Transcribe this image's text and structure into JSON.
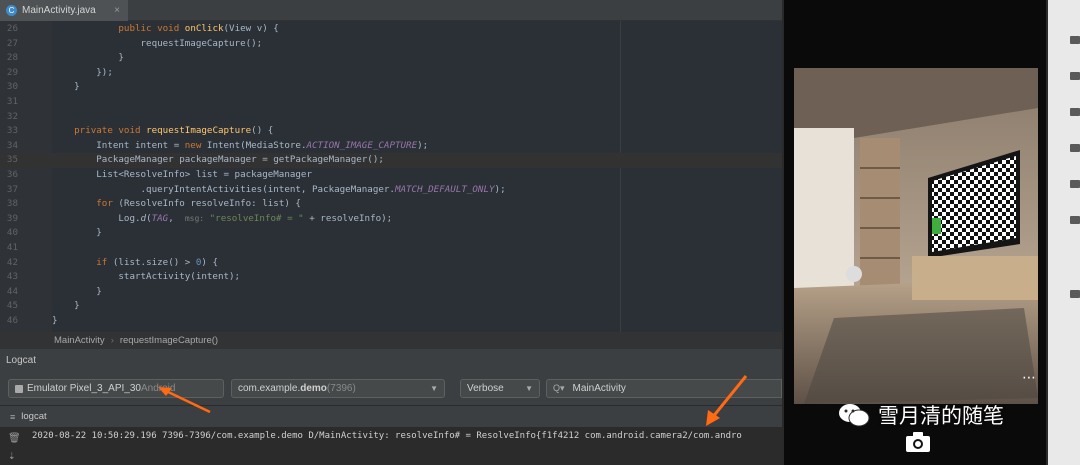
{
  "editor_tab": {
    "title": "MainActivity.java",
    "close": "×"
  },
  "code_lines": [
    {
      "n": "26",
      "html": "            <span class='kw'>public void </span><span class='fn'>onClick</span>(View v) {"
    },
    {
      "n": "27",
      "html": "                requestImageCapture();"
    },
    {
      "n": "28",
      "html": "            }"
    },
    {
      "n": "29",
      "html": "        });"
    },
    {
      "n": "30",
      "html": "    }"
    },
    {
      "n": "31",
      "html": ""
    },
    {
      "n": "32",
      "html": ""
    },
    {
      "n": "33",
      "html": "    <span class='kw'>private void </span><span class='fn'>requestImageCapture</span>() {"
    },
    {
      "n": "34",
      "html": "        Intent intent = <span class='kw'>new </span>Intent(MediaStore.<span class='it'>ACTION_IMAGE_CAPTURE</span>);"
    },
    {
      "n": "35",
      "html": "        PackageManager packageManager = getPackageManager();"
    },
    {
      "n": "36",
      "html": "        List&lt;ResolveInfo&gt; list = packageManager"
    },
    {
      "n": "37",
      "html": "                .queryIntentActivities(intent, PackageManager.<span class='it'>MATCH_DEFAULT_ONLY</span>);"
    },
    {
      "n": "38",
      "html": "        <span class='kw'>for </span>(ResolveInfo resolveInfo: list) {"
    },
    {
      "n": "39",
      "html": "            Log.<span style='font-style:italic'>d</span>(<span class='it'>TAG</span>,  <span class='hint'>msg:</span> <span class='st'>\"resolveInfo# = \"</span> + resolveInfo);"
    },
    {
      "n": "40",
      "html": "        }"
    },
    {
      "n": "41",
      "html": ""
    },
    {
      "n": "42",
      "html": "        <span class='kw'>if </span>(list.size() &gt; <span style='color:#6897bb'>0</span>) {"
    },
    {
      "n": "43",
      "html": "            startActivity(intent);"
    },
    {
      "n": "44",
      "html": "        }"
    },
    {
      "n": "45",
      "html": "    }"
    },
    {
      "n": "46",
      "html": "}"
    }
  ],
  "breadcrumbs": {
    "class_name": "MainActivity",
    "sep": "›",
    "method": "requestImageCapture()"
  },
  "logcat": {
    "title": "Logcat",
    "device": {
      "name": "Emulator Pixel_3_API_30",
      "suffix": " Android"
    },
    "process": {
      "prefix": "com.example.",
      "bold": "demo",
      "pid": " (7396)"
    },
    "level": "Verbose",
    "search": {
      "placeholder": "MainActivity",
      "icon": "Q▾"
    },
    "tab_label": "logcat",
    "log_line": "2020-08-22 10:50:29.196 7396-7396/com.example.demo D/MainActivity: resolveInfo# = ResolveInfo{f1f4212 com.android.camera2/com.andro"
  },
  "watermark": {
    "text": "雪月清的随笔"
  },
  "colors": {
    "accent": "#ff6a13",
    "ide_bg": "#2b3036"
  }
}
